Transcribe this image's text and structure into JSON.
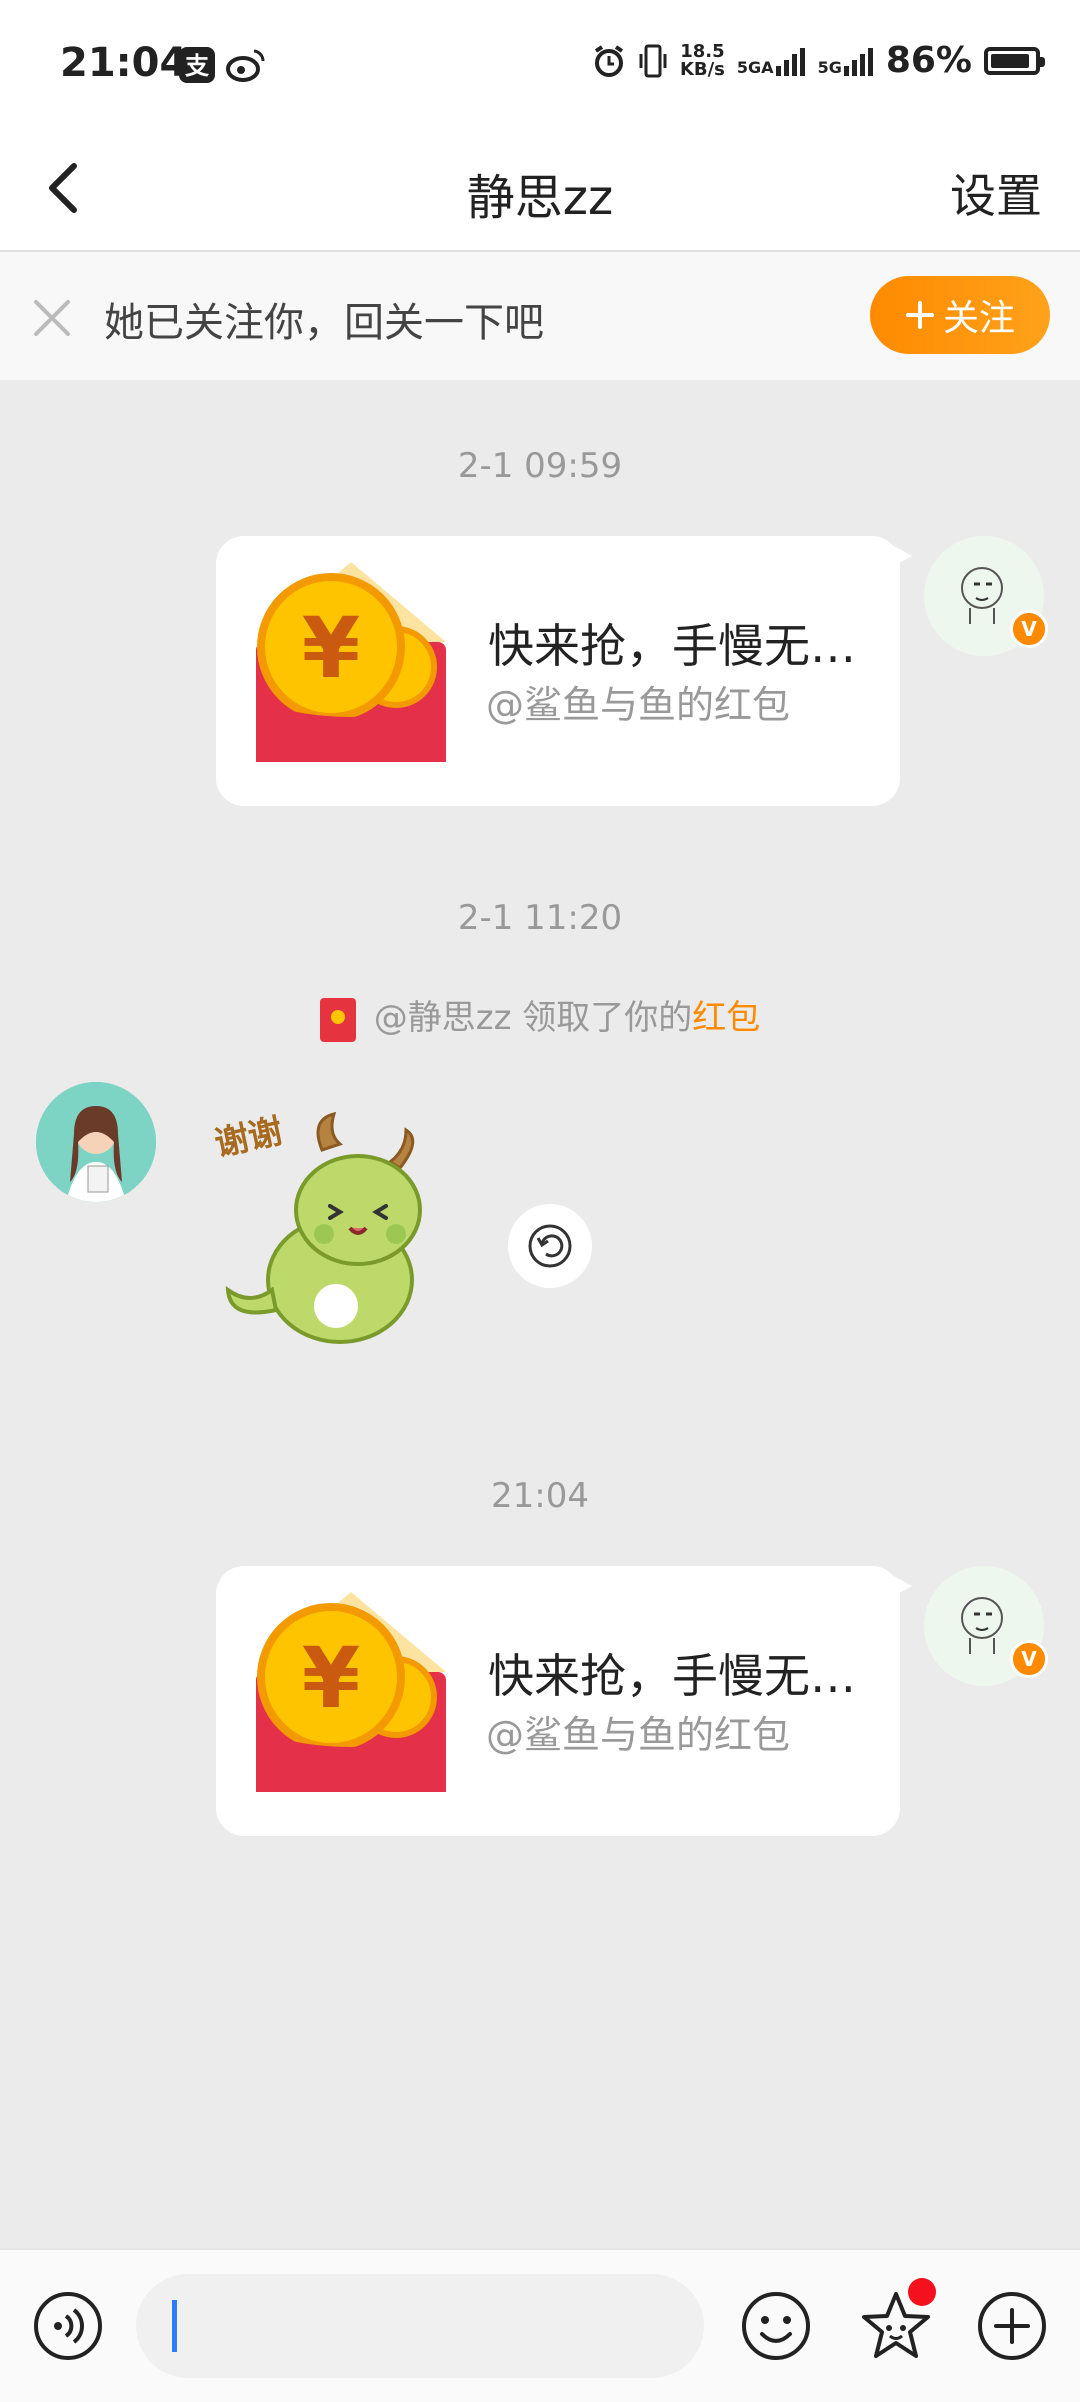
{
  "status_bar": {
    "time": "21:04",
    "speed_value": "18.5",
    "speed_unit": "KB/s",
    "network1": "5GA",
    "network2": "5G",
    "battery": "86%"
  },
  "header": {
    "title": "静思zz",
    "settings_label": "设置"
  },
  "follow_prompt": {
    "text": "她已关注你，回关一下吧",
    "button_label": "关注"
  },
  "messages": [
    {
      "timestamp": "2-1 09:59",
      "type": "red_packet",
      "title": "快来抢，手慢无…",
      "subtitle": "@鲨鱼与鱼的红包",
      "badge": "V"
    },
    {
      "timestamp": "2-1 11:20",
      "system_note_prefix": "@静思zz 领取了你的",
      "system_note_link": "红包",
      "sticker_text": "谢谢"
    },
    {
      "timestamp": "21:04",
      "type": "red_packet",
      "title": "快来抢，手慢无…",
      "subtitle": "@鲨鱼与鱼的红包",
      "badge": "V"
    }
  ],
  "colors": {
    "accent_orange": "#ff8a00",
    "red_packet": "#e5343f",
    "caret": "#2f7bff"
  }
}
